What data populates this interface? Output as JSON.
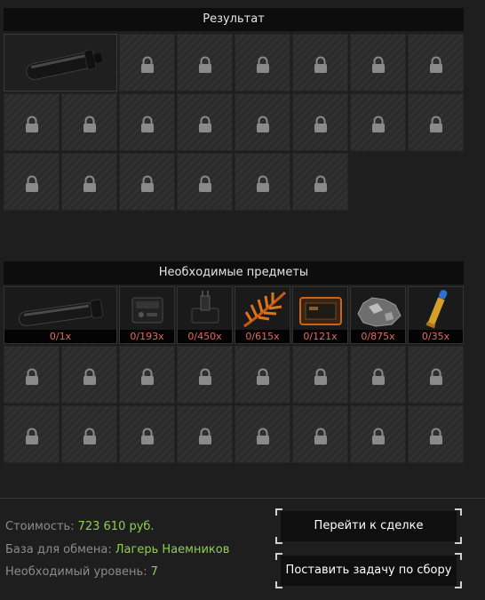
{
  "result_panel": {
    "title": "Результат",
    "result_item": {
      "icon": "silencer-icon"
    },
    "locked_slots": 20
  },
  "required_panel": {
    "title": "Необходимые предметы",
    "items": [
      {
        "icon": "silencer-icon",
        "qty": "0/1x"
      },
      {
        "icon": "device-box-icon",
        "qty": "0/193x"
      },
      {
        "icon": "electronics-icon",
        "qty": "0/450x"
      },
      {
        "icon": "fern-plant-icon",
        "qty": "0/615x"
      },
      {
        "icon": "orange-panel-icon",
        "qty": "0/121x"
      },
      {
        "icon": "ore-chunk-icon",
        "qty": "0/875x"
      },
      {
        "icon": "cartridge-icon",
        "qty": "0/35x"
      }
    ],
    "locked_slots": 16
  },
  "info": {
    "cost_label": "Стоимость:",
    "cost_value": "723 610 руб.",
    "base_label": "База для обмена:",
    "base_value": "Лагерь Наемников",
    "level_label": "Необходимый уровень:",
    "level_value": "7"
  },
  "buttons": {
    "deal": "Перейти к сделке",
    "task": "Поставить задачу по сбору"
  },
  "colors": {
    "accent_green": "#8fcf4e",
    "qty_red": "#e46a5e"
  }
}
